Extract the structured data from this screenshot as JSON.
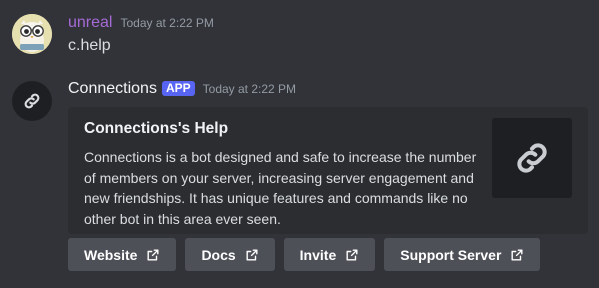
{
  "messages": [
    {
      "username": "unreal",
      "timestamp": "Today at 2:22 PM",
      "text": "c.help"
    },
    {
      "username": "Connections",
      "badge": "APP",
      "timestamp": "Today at 2:22 PM",
      "embed": {
        "title": "Connections's Help",
        "description": "Connections is a bot designed and safe to increase the number of members on your server, increasing server engagement and new friendships. It has unique features and commands like no other bot in this area ever seen."
      },
      "buttons": [
        {
          "label": "Website",
          "icon": "external-link-icon"
        },
        {
          "label": "Docs",
          "icon": "external-link-icon"
        },
        {
          "label": "Invite",
          "icon": "external-link-icon"
        },
        {
          "label": "Support Server",
          "icon": "external-link-icon"
        }
      ]
    }
  ],
  "colors": {
    "background": "#313338",
    "embed_background": "#2b2d31",
    "user_name": "#a66ad6",
    "app_badge": "#5865f2",
    "button": "#4e5058"
  }
}
